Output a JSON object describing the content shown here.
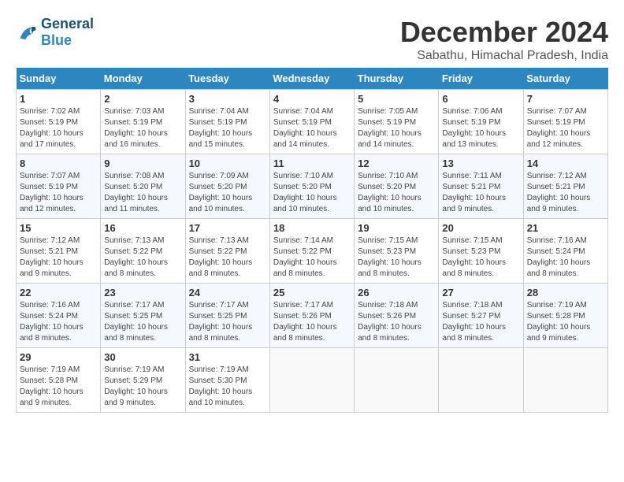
{
  "header": {
    "logo_general": "General",
    "logo_blue": "Blue",
    "month_title": "December 2024",
    "subtitle": "Sabathu, Himachal Pradesh, India"
  },
  "weekdays": [
    "Sunday",
    "Monday",
    "Tuesday",
    "Wednesday",
    "Thursday",
    "Friday",
    "Saturday"
  ],
  "weeks": [
    [
      {
        "day": 1,
        "info": "Sunrise: 7:02 AM\nSunset: 5:19 PM\nDaylight: 10 hours\nand 17 minutes."
      },
      {
        "day": 2,
        "info": "Sunrise: 7:03 AM\nSunset: 5:19 PM\nDaylight: 10 hours\nand 16 minutes."
      },
      {
        "day": 3,
        "info": "Sunrise: 7:04 AM\nSunset: 5:19 PM\nDaylight: 10 hours\nand 15 minutes."
      },
      {
        "day": 4,
        "info": "Sunrise: 7:04 AM\nSunset: 5:19 PM\nDaylight: 10 hours\nand 14 minutes."
      },
      {
        "day": 5,
        "info": "Sunrise: 7:05 AM\nSunset: 5:19 PM\nDaylight: 10 hours\nand 14 minutes."
      },
      {
        "day": 6,
        "info": "Sunrise: 7:06 AM\nSunset: 5:19 PM\nDaylight: 10 hours\nand 13 minutes."
      },
      {
        "day": 7,
        "info": "Sunrise: 7:07 AM\nSunset: 5:19 PM\nDaylight: 10 hours\nand 12 minutes."
      }
    ],
    [
      {
        "day": 8,
        "info": "Sunrise: 7:07 AM\nSunset: 5:19 PM\nDaylight: 10 hours\nand 12 minutes."
      },
      {
        "day": 9,
        "info": "Sunrise: 7:08 AM\nSunset: 5:20 PM\nDaylight: 10 hours\nand 11 minutes."
      },
      {
        "day": 10,
        "info": "Sunrise: 7:09 AM\nSunset: 5:20 PM\nDaylight: 10 hours\nand 10 minutes."
      },
      {
        "day": 11,
        "info": "Sunrise: 7:10 AM\nSunset: 5:20 PM\nDaylight: 10 hours\nand 10 minutes."
      },
      {
        "day": 12,
        "info": "Sunrise: 7:10 AM\nSunset: 5:20 PM\nDaylight: 10 hours\nand 10 minutes."
      },
      {
        "day": 13,
        "info": "Sunrise: 7:11 AM\nSunset: 5:21 PM\nDaylight: 10 hours\nand 9 minutes."
      },
      {
        "day": 14,
        "info": "Sunrise: 7:12 AM\nSunset: 5:21 PM\nDaylight: 10 hours\nand 9 minutes."
      }
    ],
    [
      {
        "day": 15,
        "info": "Sunrise: 7:12 AM\nSunset: 5:21 PM\nDaylight: 10 hours\nand 9 minutes."
      },
      {
        "day": 16,
        "info": "Sunrise: 7:13 AM\nSunset: 5:22 PM\nDaylight: 10 hours\nand 8 minutes."
      },
      {
        "day": 17,
        "info": "Sunrise: 7:13 AM\nSunset: 5:22 PM\nDaylight: 10 hours\nand 8 minutes."
      },
      {
        "day": 18,
        "info": "Sunrise: 7:14 AM\nSunset: 5:22 PM\nDaylight: 10 hours\nand 8 minutes."
      },
      {
        "day": 19,
        "info": "Sunrise: 7:15 AM\nSunset: 5:23 PM\nDaylight: 10 hours\nand 8 minutes."
      },
      {
        "day": 20,
        "info": "Sunrise: 7:15 AM\nSunset: 5:23 PM\nDaylight: 10 hours\nand 8 minutes."
      },
      {
        "day": 21,
        "info": "Sunrise: 7:16 AM\nSunset: 5:24 PM\nDaylight: 10 hours\nand 8 minutes."
      }
    ],
    [
      {
        "day": 22,
        "info": "Sunrise: 7:16 AM\nSunset: 5:24 PM\nDaylight: 10 hours\nand 8 minutes."
      },
      {
        "day": 23,
        "info": "Sunrise: 7:17 AM\nSunset: 5:25 PM\nDaylight: 10 hours\nand 8 minutes."
      },
      {
        "day": 24,
        "info": "Sunrise: 7:17 AM\nSunset: 5:25 PM\nDaylight: 10 hours\nand 8 minutes."
      },
      {
        "day": 25,
        "info": "Sunrise: 7:17 AM\nSunset: 5:26 PM\nDaylight: 10 hours\nand 8 minutes."
      },
      {
        "day": 26,
        "info": "Sunrise: 7:18 AM\nSunset: 5:26 PM\nDaylight: 10 hours\nand 8 minutes."
      },
      {
        "day": 27,
        "info": "Sunrise: 7:18 AM\nSunset: 5:27 PM\nDaylight: 10 hours\nand 8 minutes."
      },
      {
        "day": 28,
        "info": "Sunrise: 7:19 AM\nSunset: 5:28 PM\nDaylight: 10 hours\nand 9 minutes."
      }
    ],
    [
      {
        "day": 29,
        "info": "Sunrise: 7:19 AM\nSunset: 5:28 PM\nDaylight: 10 hours\nand 9 minutes."
      },
      {
        "day": 30,
        "info": "Sunrise: 7:19 AM\nSunset: 5:29 PM\nDaylight: 10 hours\nand 9 minutes."
      },
      {
        "day": 31,
        "info": "Sunrise: 7:19 AM\nSunset: 5:30 PM\nDaylight: 10 hours\nand 10 minutes."
      },
      null,
      null,
      null,
      null
    ]
  ]
}
